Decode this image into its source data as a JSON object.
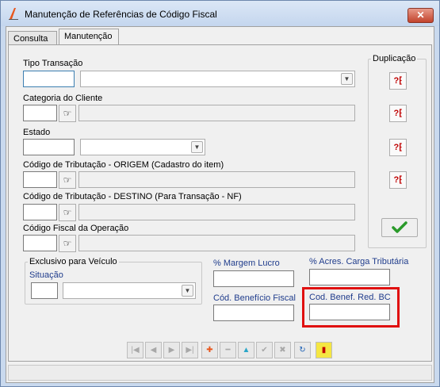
{
  "window": {
    "title": "Manutenção de Referências de Código Fiscal",
    "close_label": "✕"
  },
  "tabs": [
    {
      "label": "Consulta",
      "active": false
    },
    {
      "label": "Manutenção",
      "active": true
    }
  ],
  "form": {
    "tipo_transacao": {
      "label": "Tipo Transação",
      "code": "",
      "description": ""
    },
    "categoria_cliente": {
      "label": "Categoria do Cliente",
      "code": "",
      "description": ""
    },
    "estado": {
      "label": "Estado",
      "code": "",
      "description": ""
    },
    "cst_origem": {
      "label": "Código de Tributação - ORIGEM (Cadastro do item)",
      "code": "",
      "description": ""
    },
    "cst_destino": {
      "label": "Código de Tributação - DESTINO (Para Transação - NF)",
      "code": "",
      "description": ""
    },
    "cfop": {
      "label": "Código Fiscal da Operação",
      "code": "",
      "description": ""
    },
    "exclusivo_veiculo": {
      "group_label": "Exclusivo para Veículo",
      "situacao_label": "Situação",
      "code": "",
      "selected": ""
    },
    "margem_lucro": {
      "label": "% Margem Lucro",
      "value": ""
    },
    "acres_carga": {
      "label": "% Acres. Carga Tributária",
      "value": ""
    },
    "cod_beneficio_fiscal": {
      "label": "Cód. Benefício Fiscal",
      "value": ""
    },
    "cod_benef_red_bc": {
      "label": "Cod. Benef. Red. BC",
      "value": ""
    }
  },
  "duplicacao": {
    "label": "Duplicação",
    "button_glyph": "?⁅"
  },
  "icons": {
    "pick": "pointing-hand-icon",
    "ok": "checkmark-icon",
    "dup": "duplicate-icon"
  },
  "toolbar": {
    "buttons": [
      {
        "name": "first",
        "glyph": "|◀"
      },
      {
        "name": "prev",
        "glyph": "◀"
      },
      {
        "name": "next",
        "glyph": "▶"
      },
      {
        "name": "last",
        "glyph": "▶|"
      },
      {
        "name": "add",
        "glyph": "✚"
      },
      {
        "name": "delete",
        "glyph": "━"
      },
      {
        "name": "edit",
        "glyph": "▲"
      },
      {
        "name": "confirm",
        "glyph": "✔"
      },
      {
        "name": "cancel",
        "glyph": "✖"
      },
      {
        "name": "refresh",
        "glyph": "↻"
      },
      {
        "name": "exit",
        "glyph": "▮"
      }
    ]
  },
  "colors": {
    "highlight": "#e01010",
    "label_blue": "#1f3c8c",
    "ok_check": "#2a9a2a"
  }
}
